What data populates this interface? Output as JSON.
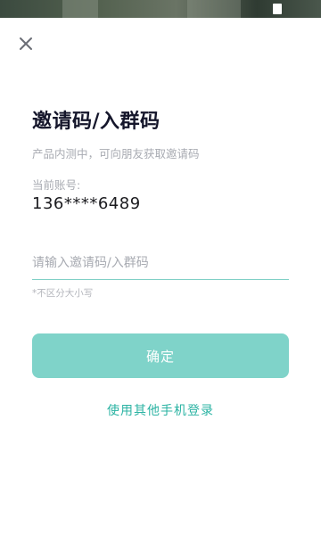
{
  "icons": {
    "close": "close-icon"
  },
  "page": {
    "title": "邀请码/入群码",
    "subtitle": "产品内测中，可向朋友获取邀请码"
  },
  "account": {
    "label": "当前账号:",
    "number": "136****6489"
  },
  "invite_input": {
    "value": "",
    "placeholder": "请输入邀请码/入群码",
    "hint": "*不区分大小写"
  },
  "actions": {
    "confirm_label": "确定",
    "alt_login_label": "使用其他手机登录"
  },
  "colors": {
    "accent": "#2bb3a3",
    "button_bg": "#7fd3c9",
    "title_text": "#15162b",
    "muted_text": "#a8abb2"
  }
}
